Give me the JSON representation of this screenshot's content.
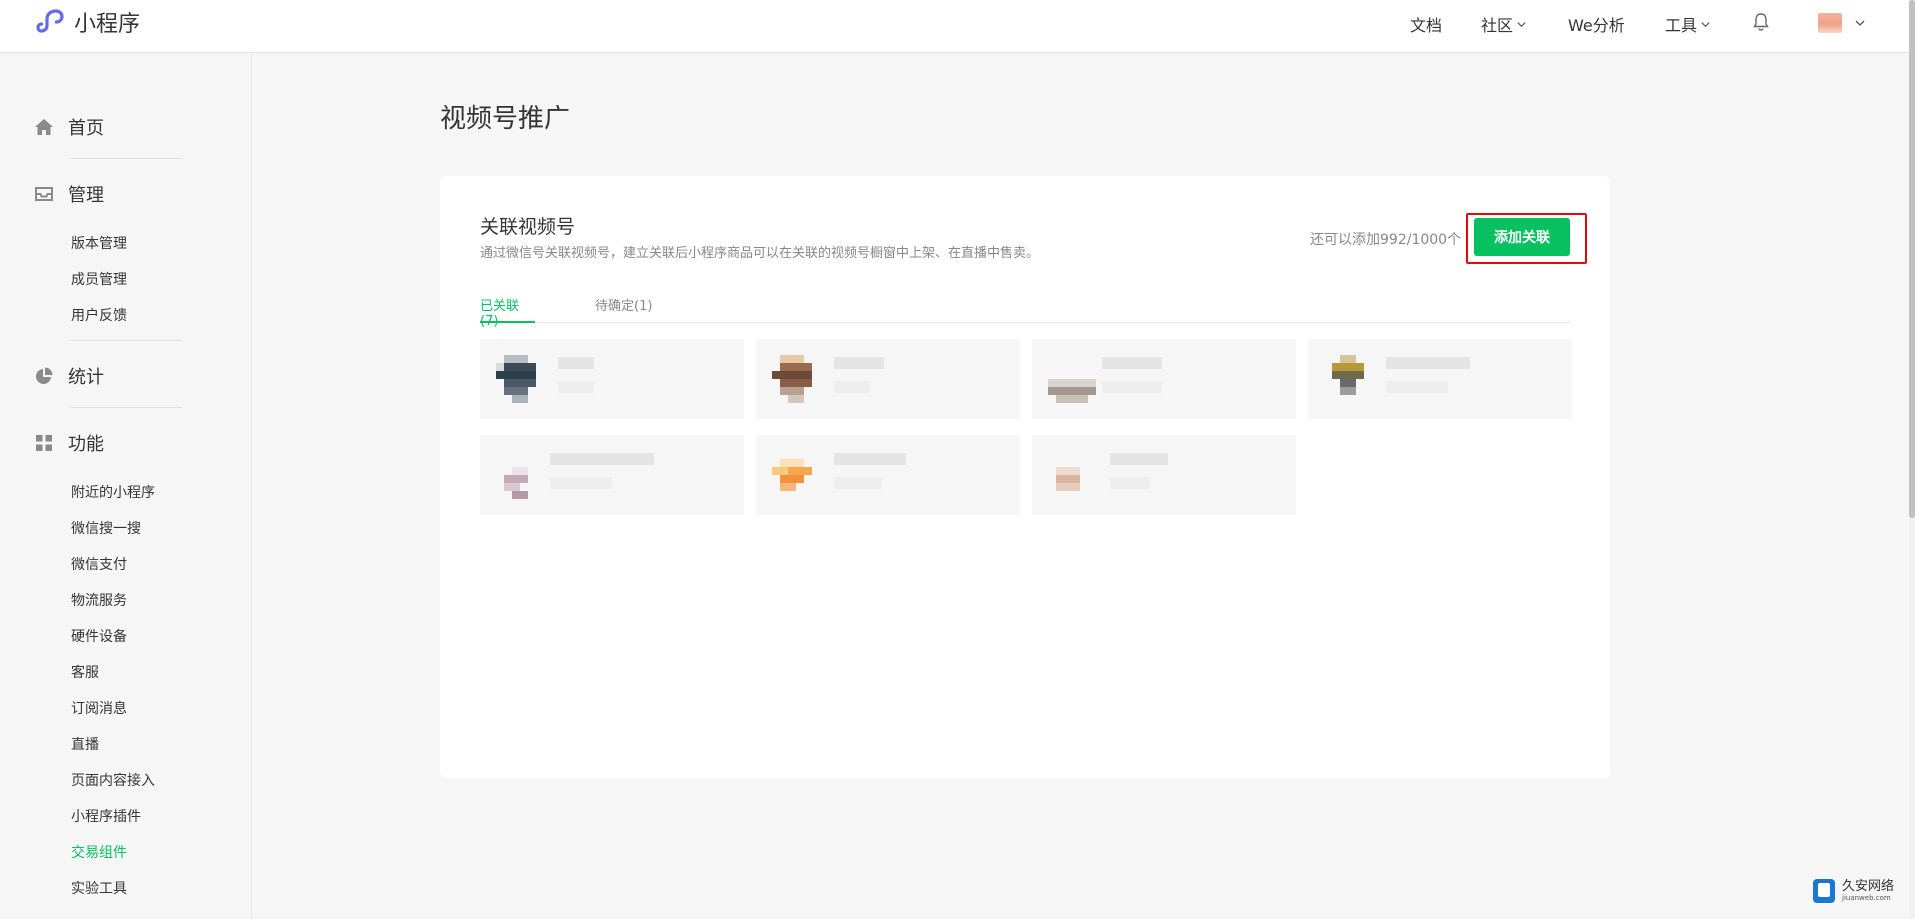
{
  "header": {
    "brand": "小程序",
    "nav": {
      "docs": "文档",
      "community": "社区",
      "analysis": "We分析",
      "tools": "工具"
    }
  },
  "sidebar": {
    "home": "首页",
    "manage": {
      "label": "管理",
      "items": [
        "版本管理",
        "成员管理",
        "用户反馈"
      ]
    },
    "stats": "统计",
    "features": {
      "label": "功能",
      "items": [
        "附近的小程序",
        "微信搜一搜",
        "微信支付",
        "物流服务",
        "硬件设备",
        "客服",
        "订阅消息",
        "直播",
        "页面内容接入",
        "小程序插件",
        "交易组件",
        "实验工具"
      ],
      "active": "交易组件"
    }
  },
  "main": {
    "title": "视频号推广",
    "card": {
      "title": "关联视频号",
      "desc": "通过微信号关联视频号，建立关联后小程序商品可以在关联的视频号橱窗中上架、在直播中售卖。",
      "quota": "还可以添加992/1000个",
      "add_button": "添加关联",
      "tabs": [
        "已关联(7)",
        "待确定(1)"
      ]
    }
  },
  "watermark": {
    "cn": "久安网络",
    "en": "jiuanweb.com"
  },
  "colors": {
    "accent": "#07c160",
    "highlight": "#e10a0a"
  }
}
